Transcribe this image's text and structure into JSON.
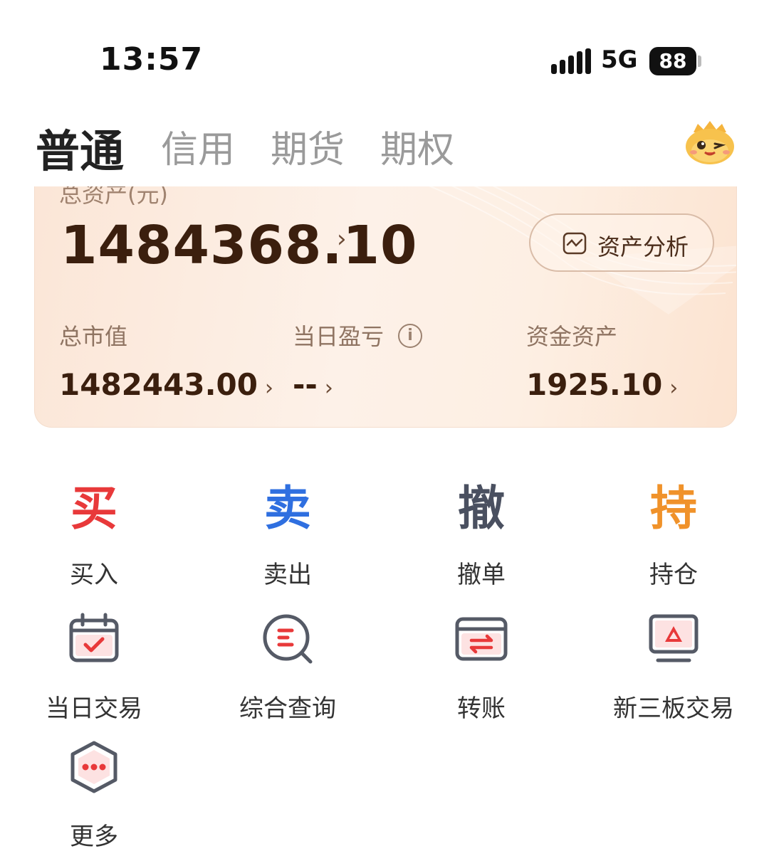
{
  "status_bar": {
    "time": "13:57",
    "network": "5G",
    "battery": "88"
  },
  "tabs": [
    {
      "label": "普通",
      "active": true
    },
    {
      "label": "信用",
      "active": false
    },
    {
      "label": "期货",
      "active": false
    },
    {
      "label": "期权",
      "active": false
    }
  ],
  "asset_card": {
    "total_label": "总资产(元)",
    "total_value": "1484368.10",
    "analysis_button": "资产分析",
    "metrics": [
      {
        "label": "总市值",
        "value": "1482443.00"
      },
      {
        "label": "当日盈亏",
        "value": "--"
      },
      {
        "label": "资金资产",
        "value": "1925.10"
      }
    ]
  },
  "actions": [
    {
      "glyph": "买",
      "label": "买入",
      "color": "#e8393a"
    },
    {
      "glyph": "卖",
      "label": "卖出",
      "color": "#2f6fe0"
    },
    {
      "glyph": "撤",
      "label": "撤单",
      "color": "#4a5060"
    },
    {
      "glyph": "持",
      "label": "持仓",
      "color": "#f0922a"
    }
  ],
  "tools": [
    {
      "icon": "calendar-check-icon",
      "label": "当日交易"
    },
    {
      "icon": "search-query-icon",
      "label": "综合查询"
    },
    {
      "icon": "transfer-card-icon",
      "label": "转账"
    },
    {
      "icon": "monitor-icon",
      "label": "新三板交易"
    },
    {
      "icon": "more-hexagon-icon",
      "label": "更多"
    }
  ],
  "colors": {
    "accent_red": "#e8393a",
    "accent_blue": "#2f6fe0",
    "accent_orange": "#f0922a",
    "card_text": "#3b1f0e"
  }
}
